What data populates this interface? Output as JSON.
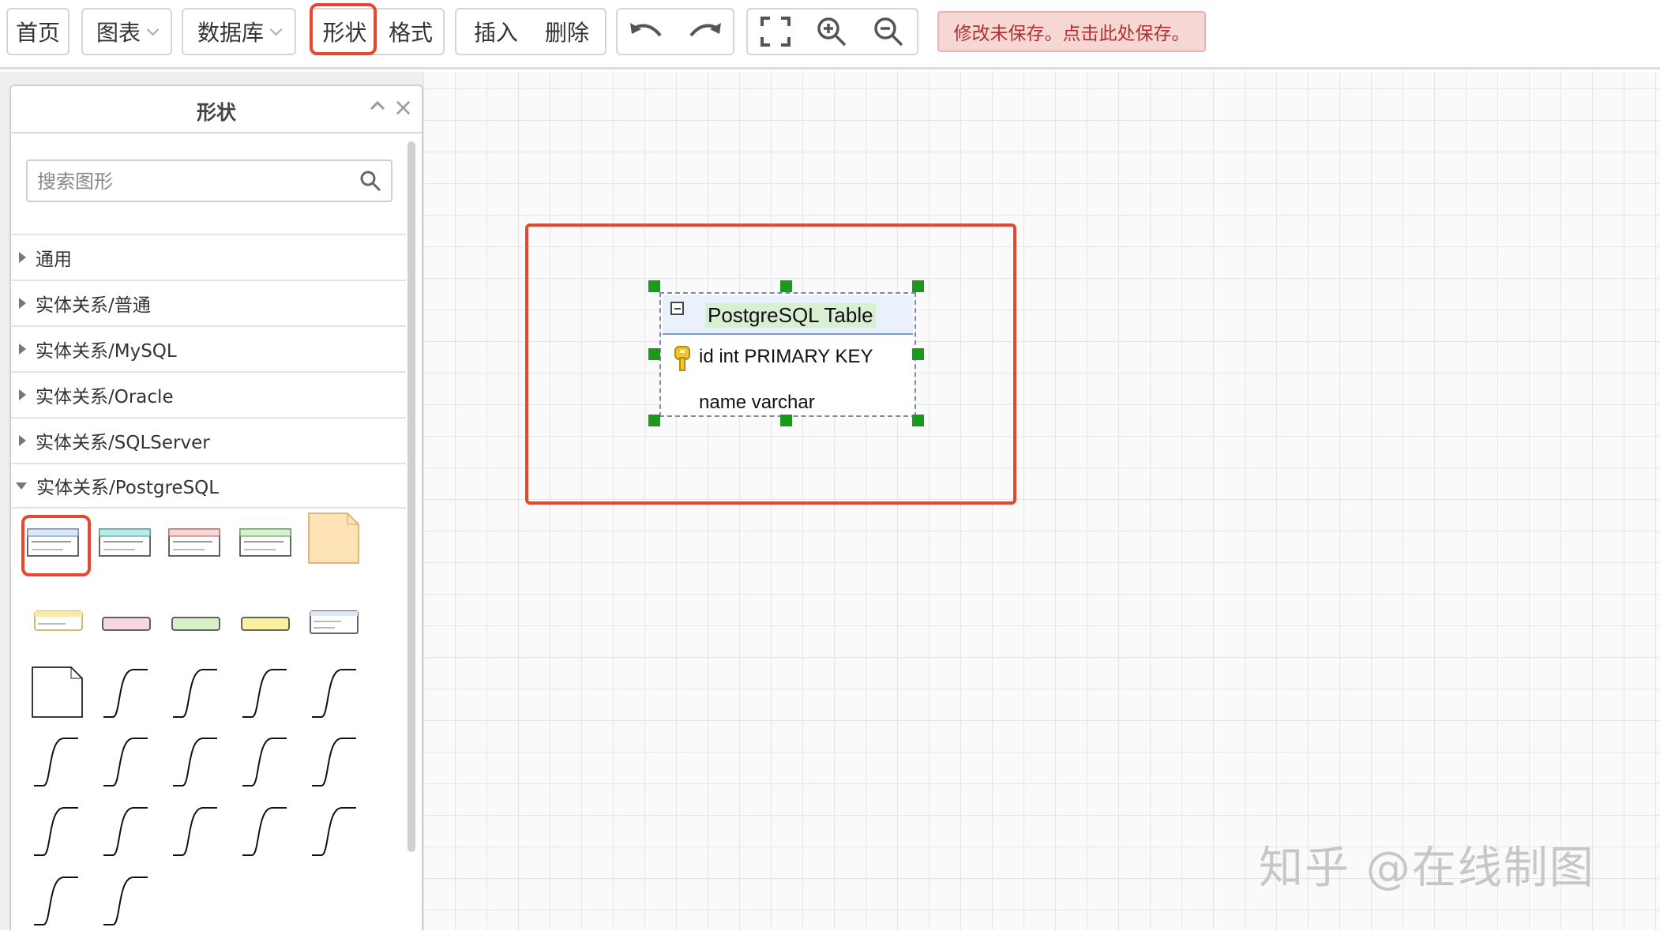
{
  "toolbar": {
    "home": "首页",
    "chart": "图表",
    "database": "数据库",
    "shape": "形状",
    "format": "格式",
    "insert": "插入",
    "delete": "删除",
    "unsaved_notice": "修改未保存。点击此处保存。"
  },
  "panel": {
    "title": "形状",
    "search_placeholder": "搜索图形",
    "categories": [
      {
        "label": "通用",
        "expanded": false
      },
      {
        "label": "实体关系/普通",
        "expanded": false
      },
      {
        "label": "实体关系/MySQL",
        "expanded": false
      },
      {
        "label": "实体关系/Oracle",
        "expanded": false
      },
      {
        "label": "实体关系/SQLServer",
        "expanded": false
      },
      {
        "label": "实体关系/PostgreSQL",
        "expanded": true
      }
    ]
  },
  "diagram": {
    "table_title": "PostgreSQL Table",
    "rows": [
      "id int PRIMARY KEY",
      "name varchar"
    ]
  },
  "watermark": "知乎 @在线制图",
  "colors": {
    "highlight": "#e8472e",
    "handle": "#1a9a1a",
    "unsaved_bg": "#f7d7d4"
  }
}
